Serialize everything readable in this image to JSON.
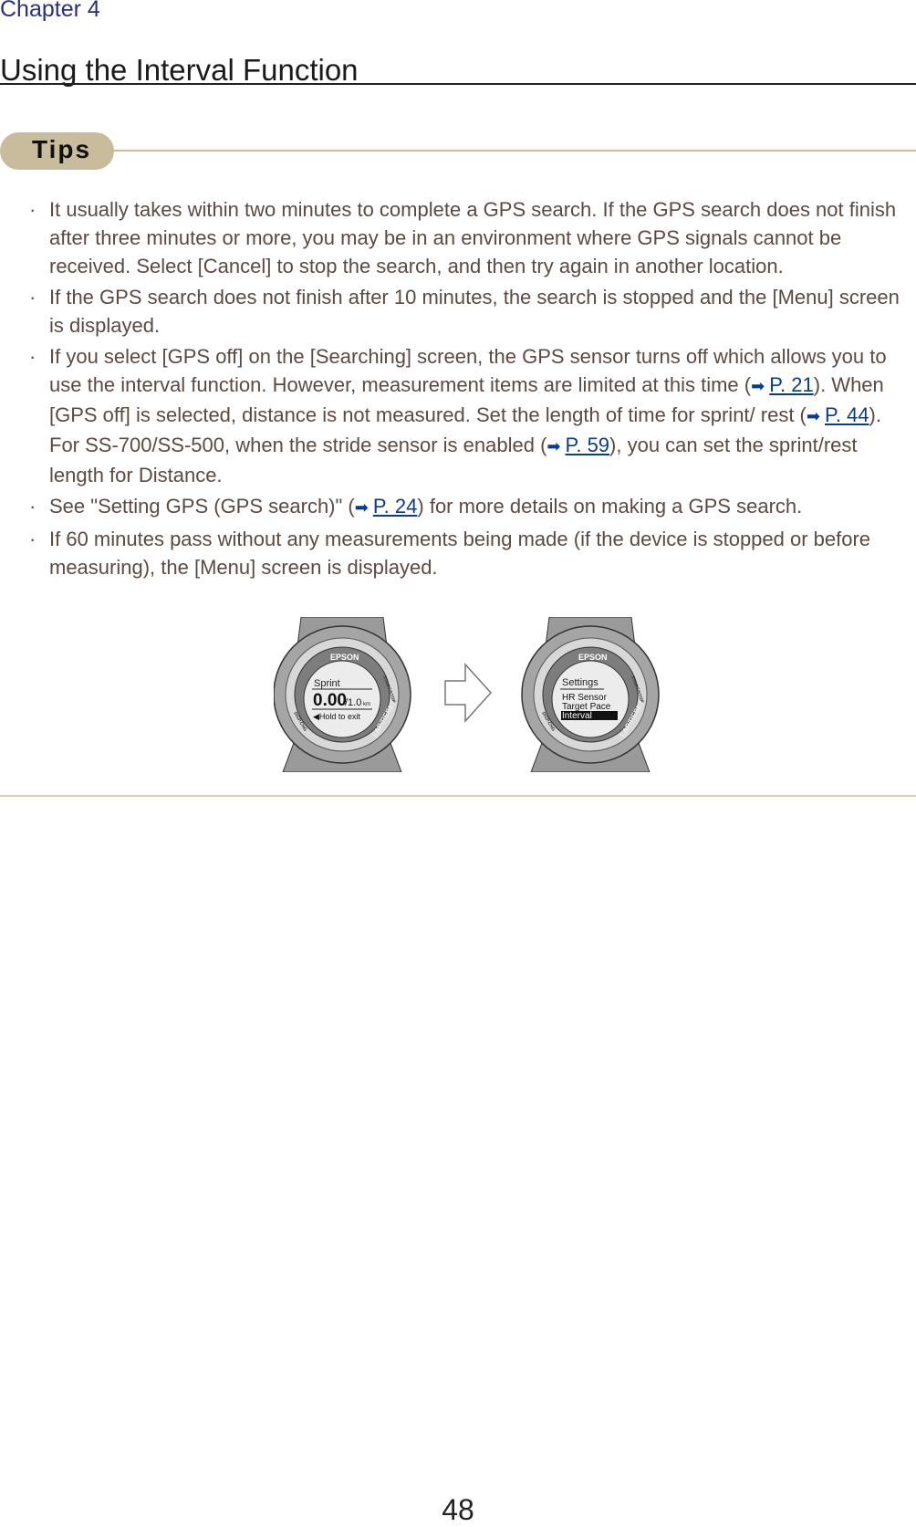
{
  "header": {
    "chapter": "Chapter 4",
    "title": "Using the Interval Function"
  },
  "tips": {
    "label": "Tips",
    "bullet_marker": "·",
    "items": [
      [
        {
          "text": "It usually takes within two minutes to complete a GPS search. If the GPS search does not finish after three minutes or more, you may be in an environment where GPS signals cannot be received. Select [Cancel] to stop the search, and then try again in another location."
        }
      ],
      [
        {
          "text": "If the GPS search does not finish after 10 minutes, the search is stopped and the [Menu] screen is displayed."
        }
      ],
      [
        {
          "text": "If you select [GPS off] on the [Searching] screen, the GPS sensor turns off which allows you to use the interval function. However, measurement items are limited at this time ("
        },
        {
          "link": "P. 21"
        },
        {
          "text": "). When [GPS off] is selected, distance is not measured. Set the length of time for sprint/ rest ("
        },
        {
          "link": "P. 44"
        },
        {
          "text": "). For SS-700/SS-500, when the stride sensor is enabled ("
        },
        {
          "link": "P. 59"
        },
        {
          "text": "), you can set the sprint/rest length for Distance."
        }
      ],
      [
        {
          "text": "See \"Setting GPS (GPS search)\" ("
        },
        {
          "link": "P. 24"
        },
        {
          "text": ") for more details on making a GPS search."
        }
      ],
      [
        {
          "text": "If 60 minutes pass without any measurements being made (if the device is stopped or before measuring), the [Menu] screen is displayed."
        }
      ]
    ]
  },
  "figure": {
    "watch1": {
      "brand": "EPSON",
      "line1": "Sprint",
      "value": "0.00",
      "target": "/1.0",
      "unit": "km",
      "line3": "◀Hold to exit",
      "btn_left": "DISP.CHG",
      "btn_right": "START/STOP",
      "btn_bottom": "LAP/RESET"
    },
    "watch2": {
      "brand": "EPSON",
      "line1": "Settings",
      "item1": "HR Sensor",
      "item2": "Target Pace",
      "item3": "Interval",
      "btn_left": "DISP.CHG",
      "btn_right": "START/STOP",
      "btn_bottom": "LAP/RESET"
    }
  },
  "colors": {
    "chapter": "#2a2f7a",
    "text": "#5b4a42",
    "link": "#0a3b8c",
    "tips_accent": "#c9bc9c"
  },
  "page_number": "48"
}
